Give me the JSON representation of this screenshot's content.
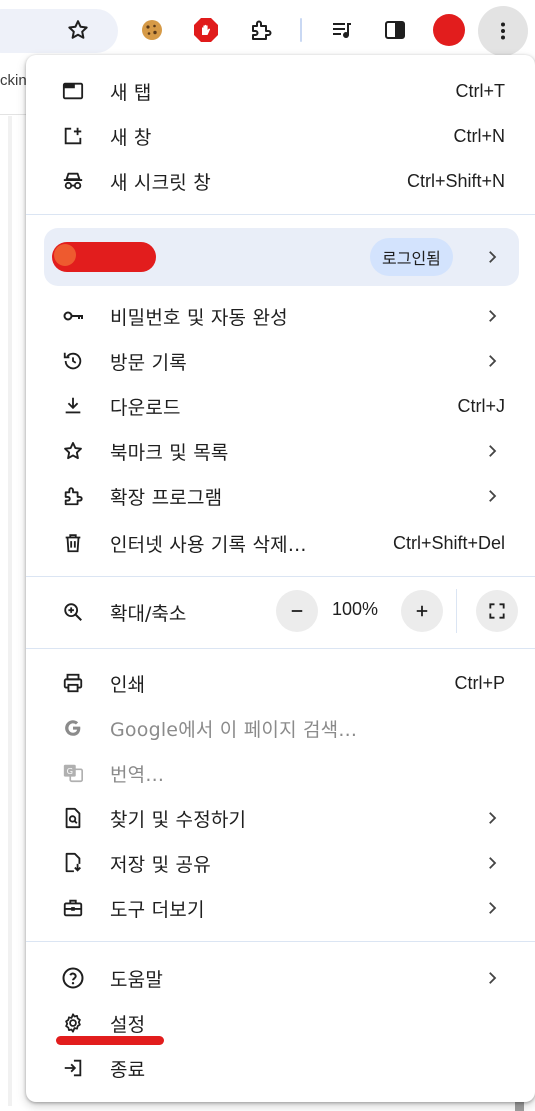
{
  "toolbar": {
    "tab_snippet": "ckin",
    "icons": [
      "star-icon",
      "cookie-extension-icon",
      "adblock-extension-icon",
      "extensions-icon",
      "reading-list-icon",
      "side-panel-icon",
      "profile-avatar",
      "more-menu-icon"
    ]
  },
  "menu": {
    "new_tab": {
      "label": "새 탭",
      "shortcut": "Ctrl+T"
    },
    "new_window": {
      "label": "새 창",
      "shortcut": "Ctrl+N"
    },
    "new_incognito": {
      "label": "새 시크릿 창",
      "shortcut": "Ctrl+Shift+N"
    },
    "profile": {
      "signed_in_label": "로그인됨"
    },
    "passwords": {
      "label": "비밀번호 및 자동 완성"
    },
    "history": {
      "label": "방문 기록"
    },
    "downloads": {
      "label": "다운로드",
      "shortcut": "Ctrl+J"
    },
    "bookmarks": {
      "label": "북마크 및 목록"
    },
    "extensions": {
      "label": "확장 프로그램"
    },
    "clear_data": {
      "label": "인터넷 사용 기록 삭제...",
      "shortcut": "Ctrl+Shift+Del"
    },
    "zoom": {
      "label": "확대/축소",
      "minus": "−",
      "value": "100%",
      "plus": "+"
    },
    "print": {
      "label": "인쇄",
      "shortcut": "Ctrl+P"
    },
    "search_google": {
      "label": "Google에서 이 페이지 검색..."
    },
    "translate": {
      "label": "번역..."
    },
    "find_edit": {
      "label": "찾기 및 수정하기"
    },
    "save_share": {
      "label": "저장 및 공유"
    },
    "more_tools": {
      "label": "도구 더보기"
    },
    "help": {
      "label": "도움말"
    },
    "settings": {
      "label": "설정"
    },
    "exit": {
      "label": "종료"
    }
  },
  "colors": {
    "menu_bg": "#ffffff",
    "profile_bg": "#e9eef8",
    "signed_in_badge": "#d3e3fd",
    "divider": "#dbe5f3",
    "annotation_red": "#e21d1d"
  }
}
